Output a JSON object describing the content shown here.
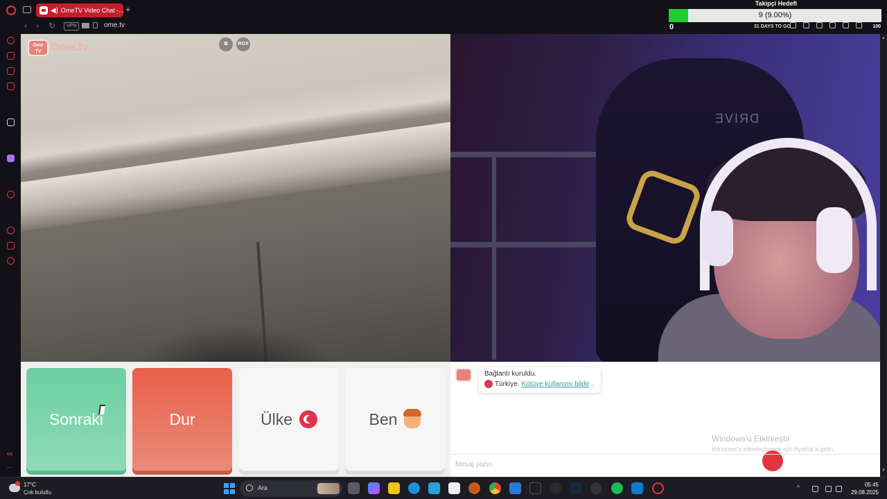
{
  "browser": {
    "tab_title": "OmeTV Video Chat -...",
    "new_tab": "+",
    "vpn_label": "VPN",
    "url": "ome.tv"
  },
  "goal_overlay": {
    "title": "Takipçi Hedefi",
    "progress_text": "9 (9.00%)",
    "progress_fraction": 0.09,
    "min": "0",
    "max": "100",
    "days": "31 DAYS TO GO",
    "fill_color": "#22cc33"
  },
  "sidebar": {
    "bottom_text": "ox"
  },
  "video_left": {
    "logo_box": "Ome TV",
    "logo_text": "Ome.tv",
    "btn_rgx": "RGX"
  },
  "video_right": {
    "chair_text": "DRIVE"
  },
  "controls": {
    "next_label": "Sonraki",
    "stop_label": "Dur",
    "country_label": "Ülke",
    "me_label": "Ben",
    "next_color": "#6ccfa1",
    "stop_color": "#e8604a"
  },
  "chat": {
    "status": "Bağlantı kuruldu.",
    "country": "Türkiye.",
    "report_link": "Kötüye kullanımı bildir",
    "report_suffix": ".",
    "win_activate_title": "Windows'u Etkinleştir",
    "win_activate_sub": "Windows'u etkinleştirmek için Ayarlar'a gidin.",
    "input_placeholder": "Mesaj yazın"
  },
  "taskbar": {
    "temp": "17°C",
    "condition": "Çok bulutlu",
    "search_label": "Ara",
    "time": "05:45",
    "date": "29.08.2025"
  }
}
